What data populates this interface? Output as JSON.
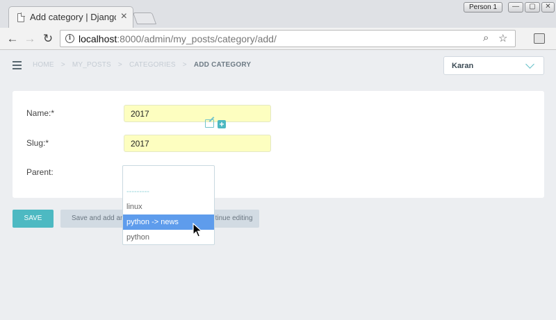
{
  "browser": {
    "tab_title": "Add category | Django site admin",
    "tab_close": "×",
    "profile_name": "Person 1",
    "window_minimize": "—",
    "window_maximize": "▢",
    "window_close": "✕",
    "url_host": "localhost",
    "url_path": ":8000/admin/my_posts/category/add/"
  },
  "breadcrumbs": {
    "home": "HOME",
    "app": "MY_POSTS",
    "model": "CATEGORIES",
    "current": "ADD CATEGORY",
    "separator": ">"
  },
  "user_menu": {
    "selected": "Karan"
  },
  "form": {
    "name_label": "Name:*",
    "name_value": "2017",
    "slug_label": "Slug:*",
    "slug_value": "2017",
    "parent_label": "Parent:"
  },
  "parent_dropdown": {
    "options": [
      "---------",
      "linux",
      "python -> news",
      "python"
    ],
    "highlighted": "python -> news"
  },
  "actions": {
    "save": "SAVE",
    "save_add_another": "Save and add another",
    "save_continue": "Save and continue editing"
  },
  "colors": {
    "accent": "#4db9c2",
    "highlight": "#5e9cec",
    "field_background": "#fdfec0"
  }
}
